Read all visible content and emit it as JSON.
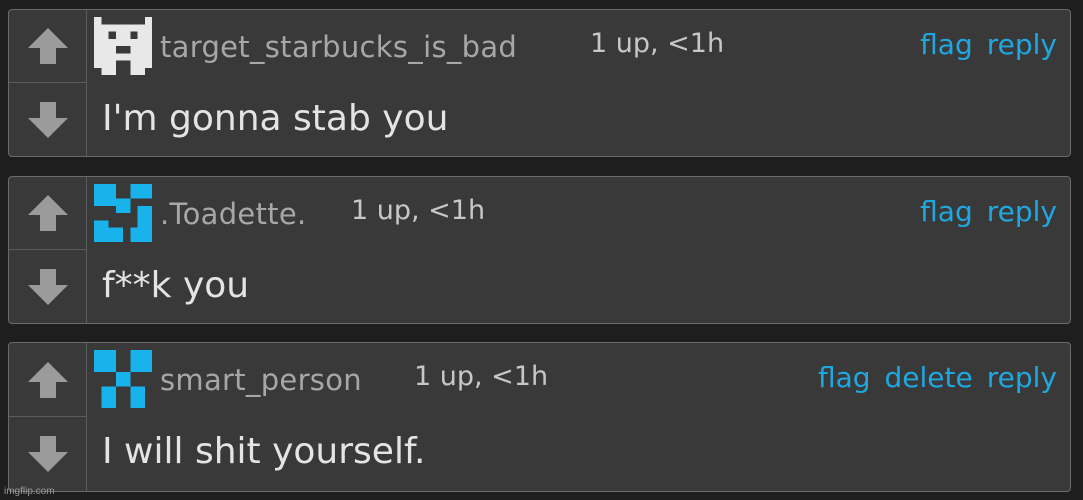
{
  "comments": [
    {
      "avatar": "white-cat-pixel-avatar",
      "avatar_color": "#e8e8e8",
      "username": "target_starbucks_is_bad",
      "meta": "1 up, <1h",
      "actions": [
        "flag",
        "reply"
      ],
      "text": "I'm gonna stab you"
    },
    {
      "avatar": "blue-pixel-avatar",
      "avatar_color": "#19b3ec",
      "username": ".Toadette.",
      "meta": "1 up, <1h",
      "actions": [
        "flag",
        "reply"
      ],
      "text": "f**k you"
    },
    {
      "avatar": "blue-pixel-avatar",
      "avatar_color": "#19b3ec",
      "username": "smart_person",
      "meta": "1 up, <1h",
      "actions": [
        "flag",
        "delete",
        "reply"
      ],
      "text": "I will shit yourself."
    }
  ],
  "watermark": "imgflip.com",
  "colors": {
    "background": "#1e1e1e",
    "panel": "#393939",
    "link": "#1fa7e0",
    "arrow": "#9b9b9b"
  }
}
